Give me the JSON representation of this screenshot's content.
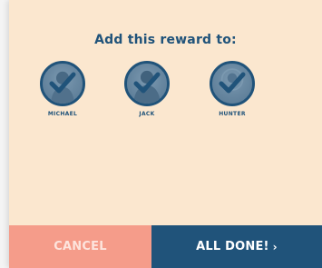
{
  "dialog": {
    "title": "Add this reward to:"
  },
  "recipients": [
    {
      "name": "MICHAEL",
      "selected": true,
      "icon": "check-icon"
    },
    {
      "name": "JACK",
      "selected": true,
      "icon": "check-icon"
    },
    {
      "name": "HUNTER",
      "selected": true,
      "icon": "check-icon"
    }
  ],
  "footer": {
    "cancel_label": "CANCEL",
    "done_label": "ALL DONE!",
    "done_icon": "chevron-right-icon",
    "done_glyph": "›"
  },
  "colors": {
    "background": "#fbe7cf",
    "accent": "#20537a",
    "cancel": "#f59c8a"
  }
}
